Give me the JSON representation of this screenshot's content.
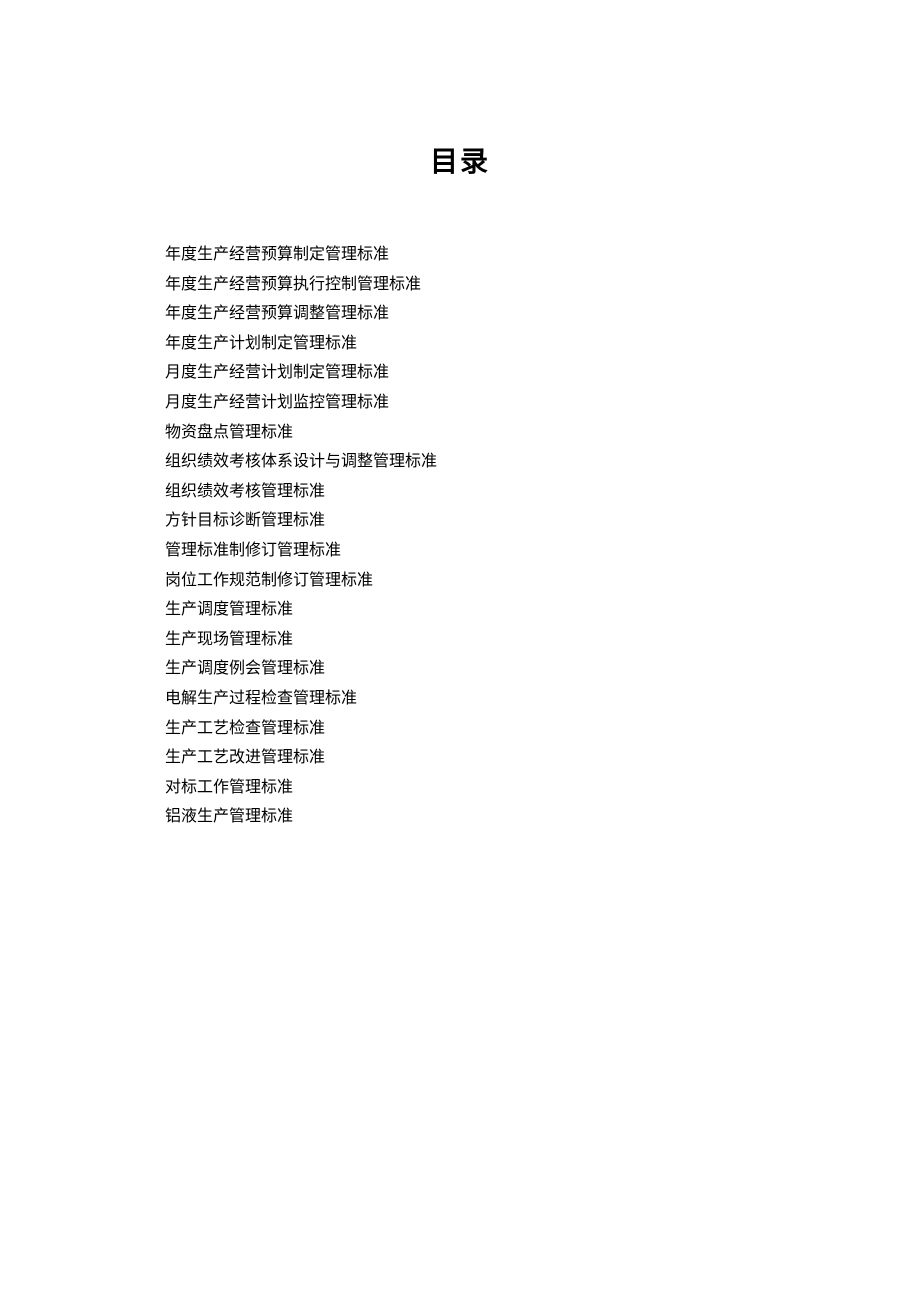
{
  "title": "目录",
  "toc": {
    "items": [
      "年度生产经营预算制定管理标准",
      "年度生产经营预算执行控制管理标准",
      "年度生产经营预算调整管理标准",
      "年度生产计划制定管理标准",
      "月度生产经营计划制定管理标准",
      "月度生产经营计划监控管理标准",
      "物资盘点管理标准",
      "组织绩效考核体系设计与调整管理标准",
      "组织绩效考核管理标准",
      "方针目标诊断管理标准",
      "管理标准制修订管理标准",
      "岗位工作规范制修订管理标准",
      "生产调度管理标准",
      "生产现场管理标准",
      "生产调度例会管理标准",
      "电解生产过程检查管理标准",
      "生产工艺检查管理标准",
      "生产工艺改进管理标准",
      "对标工作管理标准",
      "铝液生产管理标准"
    ]
  }
}
